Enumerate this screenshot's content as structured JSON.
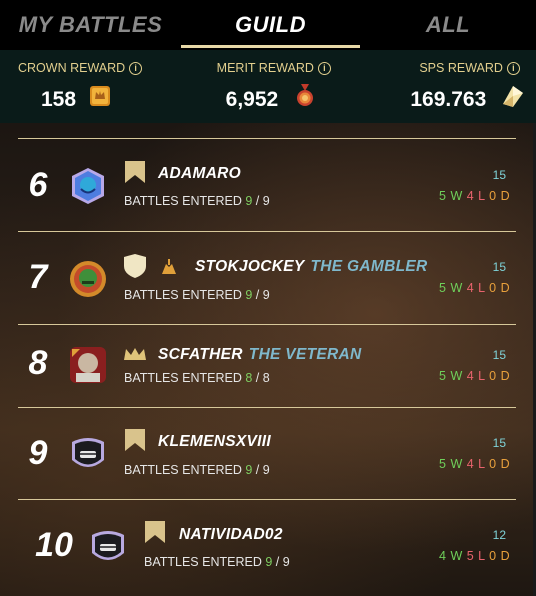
{
  "tabs": [
    {
      "label": "MY BATTLES",
      "active": false
    },
    {
      "label": "GUILD",
      "active": true
    },
    {
      "label": "ALL",
      "active": false
    }
  ],
  "rewards": [
    {
      "title": "CROWN REWARD",
      "value": "158",
      "icon": "crown-token-icon"
    },
    {
      "title": "MERIT REWARD",
      "value": "6,952",
      "icon": "merit-medal-icon"
    },
    {
      "title": "SPS REWARD",
      "value": "169.763",
      "icon": "sps-crystal-icon"
    }
  ],
  "players": [
    {
      "rank": "6",
      "name": "ADAMARO",
      "title": "",
      "entered_label": "BATTLES ENTERED",
      "entered": "9",
      "total": "9",
      "score": "15",
      "w": "5",
      "l": "4",
      "d": "0",
      "badge": "bookmark-icon"
    },
    {
      "rank": "7",
      "name": "STOKJOCKEY",
      "title": "THE GAMBLER",
      "entered_label": "BATTLES ENTERED",
      "entered": "9",
      "total": "9",
      "score": "15",
      "w": "5",
      "l": "4",
      "d": "0",
      "badge": "shield-icon"
    },
    {
      "rank": "8",
      "name": "SCFATHER",
      "title": "THE VETERAN",
      "entered_label": "BATTLES ENTERED",
      "entered": "8",
      "total": "8",
      "score": "15",
      "w": "5",
      "l": "4",
      "d": "0",
      "badge": "crown-icon"
    },
    {
      "rank": "9",
      "name": "KLEMENSXVIII",
      "title": "",
      "entered_label": "BATTLES ENTERED",
      "entered": "9",
      "total": "9",
      "score": "15",
      "w": "5",
      "l": "4",
      "d": "0",
      "badge": "bookmark-icon"
    },
    {
      "rank": "10",
      "name": "NATIVIDAD02",
      "title": "",
      "entered_label": "BATTLES ENTERED",
      "entered": "9",
      "total": "9",
      "score": "12",
      "w": "4",
      "l": "5",
      "d": "0",
      "badge": "bookmark-icon"
    }
  ],
  "wld_letters": {
    "w": "W",
    "l": "L",
    "d": "D"
  }
}
